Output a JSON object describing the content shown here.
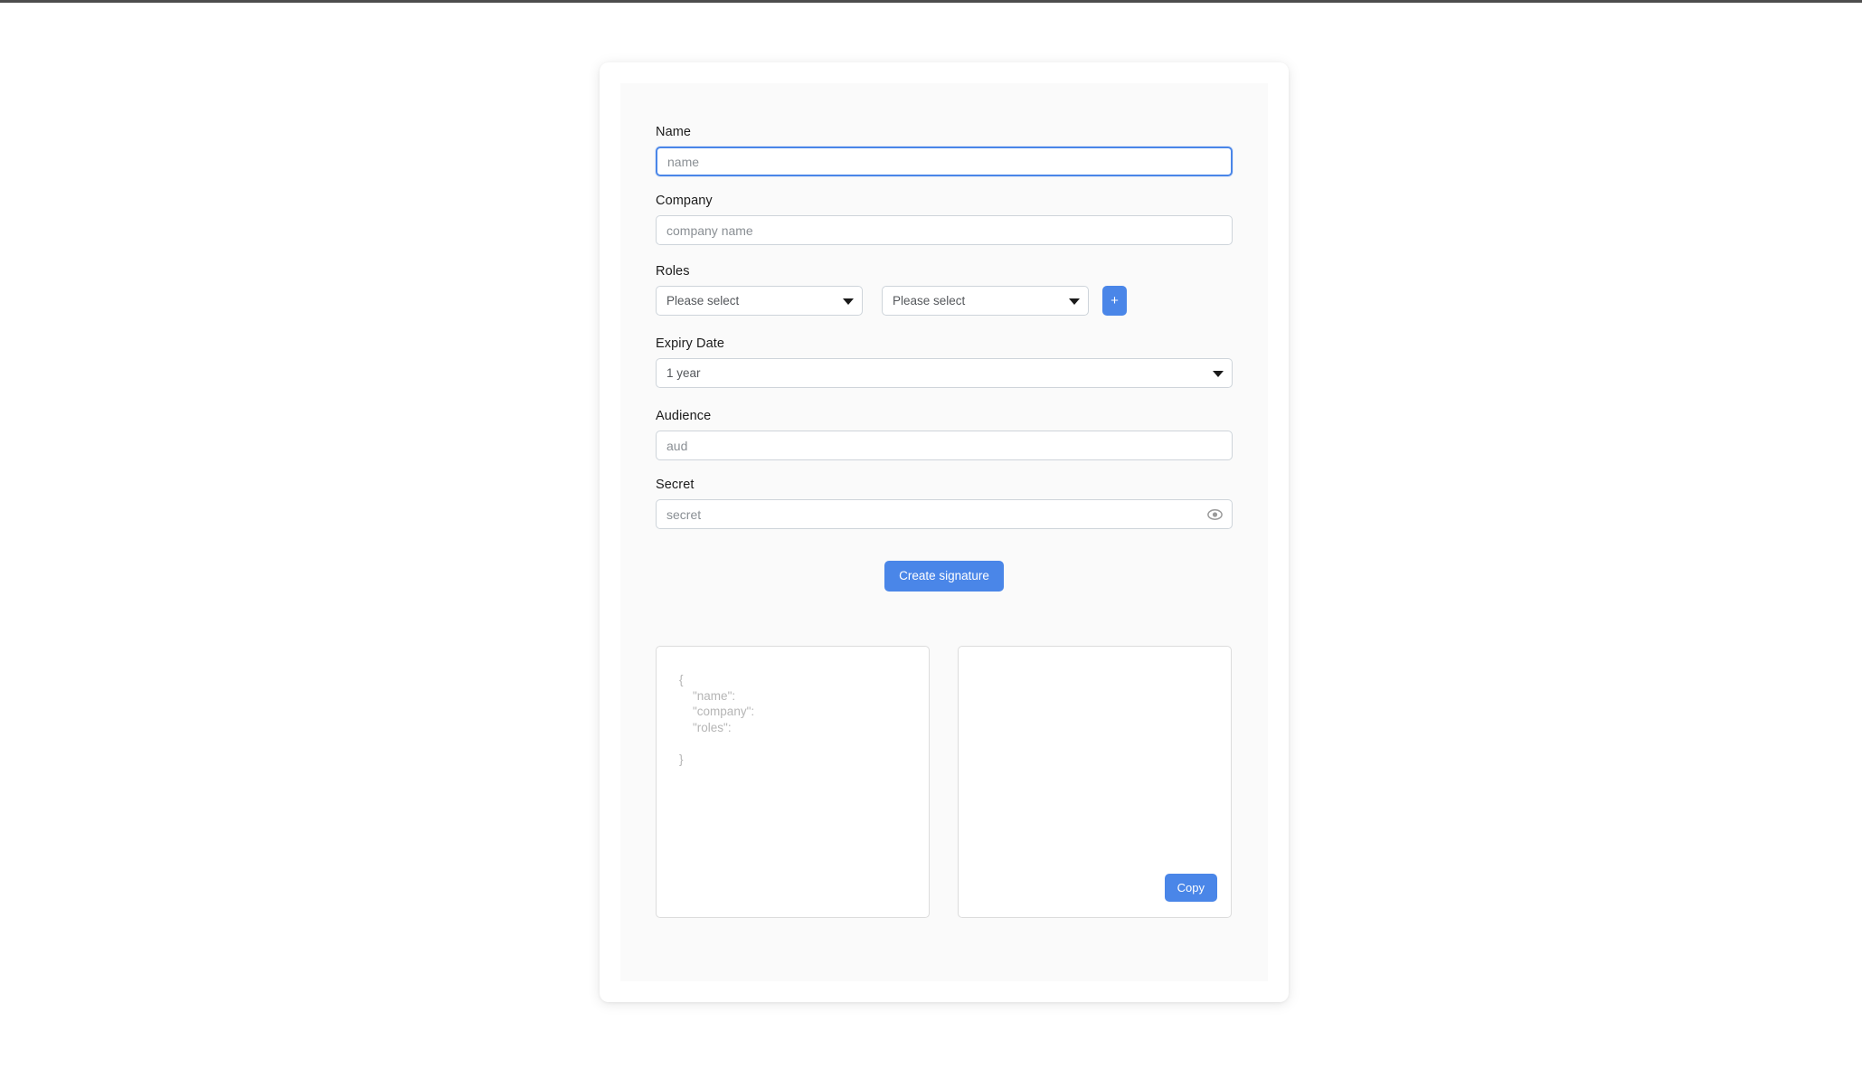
{
  "form": {
    "name": {
      "label": "Name",
      "placeholder": "name",
      "value": ""
    },
    "company": {
      "label": "Company",
      "placeholder": "company name",
      "value": ""
    },
    "roles": {
      "label": "Roles",
      "select_1_value": "Please select",
      "select_2_value": "Please select",
      "add_button_label": "+"
    },
    "expiry": {
      "label": "Expiry Date",
      "value": "1 year"
    },
    "audience": {
      "label": "Audience",
      "placeholder": "aud",
      "value": ""
    },
    "secret": {
      "label": "Secret",
      "placeholder": "secret",
      "value": "",
      "toggle_icon": "eye-icon"
    },
    "submit_label": "Create signature"
  },
  "output": {
    "payload_preview": "{\n    \"name\":\n    \"company\":\n    \"roles\":\n\n}",
    "signature_value": "",
    "copy_label": "Copy"
  },
  "colors": {
    "accent": "#4a86e8",
    "border": "#ced4da",
    "placeholder_text": "#8a8f94",
    "panel_bg": "#fafafa",
    "top_bar": "#4d4d4d"
  }
}
